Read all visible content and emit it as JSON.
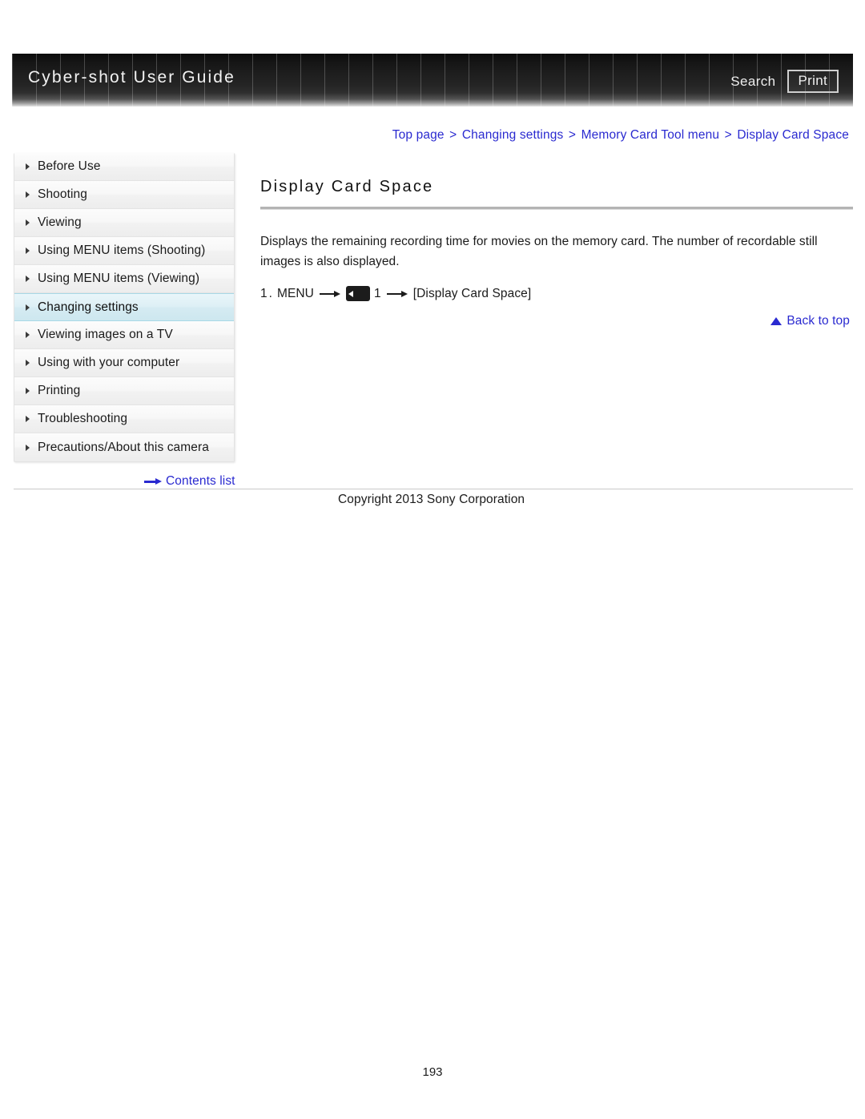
{
  "header": {
    "title": "Cyber-shot User Guide",
    "search_label": "Search",
    "print_label": "Print"
  },
  "breadcrumb": {
    "separator": ">",
    "items": [
      {
        "label": "Top page"
      },
      {
        "label": "Changing settings"
      },
      {
        "label": "Memory Card Tool menu"
      },
      {
        "label": "Display Card Space"
      }
    ]
  },
  "sidebar": {
    "items": [
      {
        "label": "Before Use",
        "selected": false
      },
      {
        "label": "Shooting",
        "selected": false
      },
      {
        "label": "Viewing",
        "selected": false
      },
      {
        "label": "Using MENU items (Shooting)",
        "selected": false
      },
      {
        "label": "Using MENU items (Viewing)",
        "selected": false
      },
      {
        "label": "Changing settings",
        "selected": true
      },
      {
        "label": "Viewing images on a TV",
        "selected": false
      },
      {
        "label": "Using with your computer",
        "selected": false
      },
      {
        "label": "Printing",
        "selected": false
      },
      {
        "label": "Troubleshooting",
        "selected": false
      },
      {
        "label": "Precautions/About this camera",
        "selected": false
      }
    ],
    "contents_list_label": "Contents list"
  },
  "main": {
    "title": "Display Card Space",
    "body": "Displays the remaining recording time for movies on the memory card. The number of recordable still images is also displayed.",
    "step": {
      "number": "1.",
      "menu_label": "MENU",
      "icon_name": "memory-card-tool-menu-icon",
      "icon_number": "1",
      "target_label": "[Display Card Space]"
    },
    "back_to_top_label": "Back to top"
  },
  "footer": {
    "copyright": "Copyright 2013 Sony Corporation",
    "page_number": "193"
  },
  "colors": {
    "link": "#2a2ad0",
    "selected_nav": "#d5ebf2",
    "rule": "#b4b4b4"
  }
}
